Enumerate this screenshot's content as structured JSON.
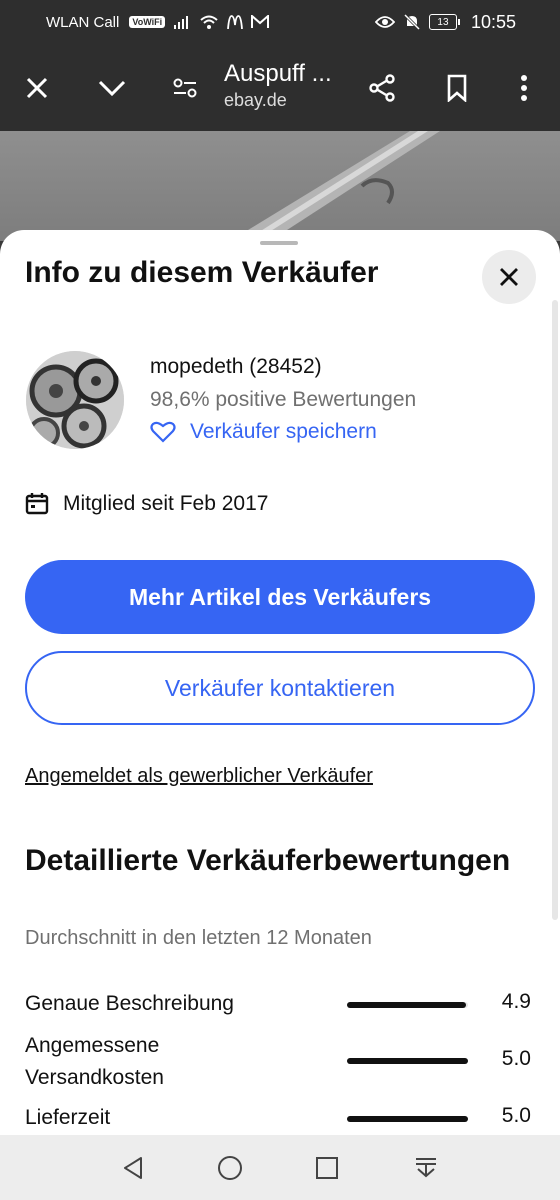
{
  "status_bar": {
    "carrier": "WLAN Call",
    "wifi_badge": "VoWiFi",
    "battery": "13",
    "time": "10:55"
  },
  "toolbar": {
    "title": "Auspuff ...",
    "domain": "ebay.de"
  },
  "sheet": {
    "title": "Info zu diesem Verkäufer",
    "seller": {
      "name": "mopedeth (28452)",
      "positive": "98,6% positive Bewertungen",
      "save_label": "Verkäufer speichern"
    },
    "member_since": "Mitglied seit Feb 2017",
    "more_items_label": "Mehr Artikel des Verkäufers",
    "contact_label": "Verkäufer kontaktieren",
    "business_link": "Angemeldet als gewerblicher Verkäufer",
    "ratings_title": "Detaillierte Verkäuferbewertungen",
    "ratings_subtitle": "Durchschnitt in den letzten 12 Monaten",
    "ratings": [
      {
        "label": "Genaue Beschreibung",
        "value": "4.9",
        "fraction": 0.98
      },
      {
        "label": "Angemessene Versandkosten",
        "value": "5.0",
        "fraction": 1.0
      },
      {
        "label": "Lieferzeit",
        "value": "5.0",
        "fraction": 1.0
      }
    ]
  },
  "colors": {
    "accent": "#3665f3",
    "bar": "#111111"
  }
}
